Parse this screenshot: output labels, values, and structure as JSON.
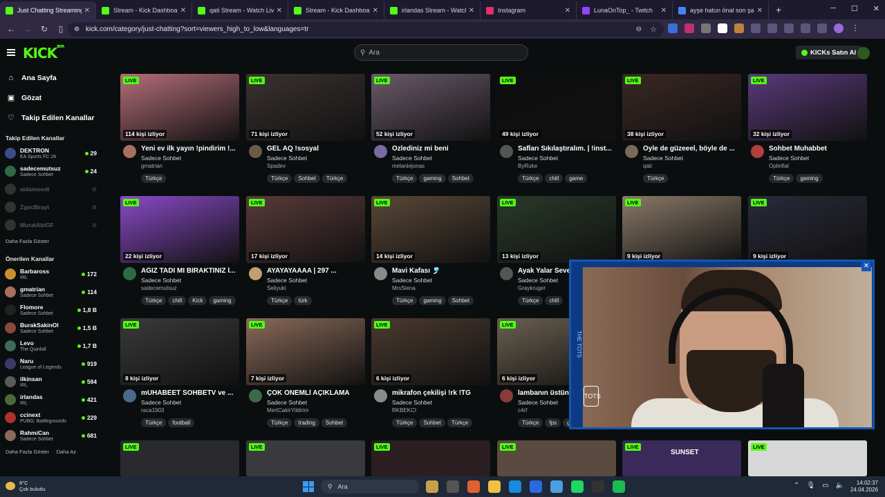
{
  "browser": {
    "tabs": [
      {
        "label": "Just Chatting Streaming",
        "active": true,
        "color": "#53fc18"
      },
      {
        "label": "Stream - Kick Dashboard",
        "color": "#53fc18"
      },
      {
        "label": "qati Stream - Watch Live o",
        "color": "#53fc18"
      },
      {
        "label": "Stream - Kick Dashboard",
        "color": "#53fc18"
      },
      {
        "label": "irlandas Stream - Watch Li",
        "color": "#53fc18"
      },
      {
        "label": "Instagram",
        "color": "#e1306c"
      },
      {
        "label": "LunaOnTop_ - Twitch",
        "color": "#9146ff"
      },
      {
        "label": "ayşe hatun önal son şarkı",
        "color": "#4285f4"
      }
    ],
    "new_tab": "+",
    "url": "kick.com/category/just-chatting?sort=viewers_high_to_low&languages=tr"
  },
  "header": {
    "logo": "KICK",
    "logo_sup": "BETA",
    "search_placeholder": "Ara",
    "kicks_button": "KICKs Satın Al"
  },
  "sidebar": {
    "nav": [
      {
        "label": "Ana Sayfa",
        "icon": "home-icon",
        "glyph": "⌂"
      },
      {
        "label": "Gözat",
        "icon": "browse-icon",
        "glyph": "▣"
      },
      {
        "label": "Takip Edilen Kanallar",
        "icon": "heart-icon",
        "glyph": "♡"
      }
    ],
    "followed_header": "Takip Edilen Kanallar",
    "followed": [
      {
        "name": "DEKTRON",
        "sub": "EA Sports FC 26",
        "count": "29",
        "live": true,
        "color": "#3a4d8a"
      },
      {
        "name": "sadecemutsuz",
        "sub": "Sadece Sohbet",
        "count": "24",
        "live": true,
        "color": "#2f6a45"
      },
      {
        "name": "aidamoodi",
        "sub": "",
        "count": "",
        "live": false,
        "color": "#777"
      },
      {
        "name": "ZgocBrayt",
        "sub": "",
        "count": "",
        "live": false,
        "color": "#777"
      },
      {
        "name": "MuratAbiGF",
        "sub": "",
        "count": "",
        "live": false,
        "color": "#777"
      }
    ],
    "more1": "Daha Fazla Göster",
    "recommended_header": "Önerilen Kanallar",
    "recommended": [
      {
        "name": "Barbaross",
        "sub": "IRL",
        "count": "172",
        "color": "#c9902e"
      },
      {
        "name": "gmatrian",
        "sub": "Sadece Sohbet",
        "count": "114",
        "color": "#a87060"
      },
      {
        "name": "Flomore",
        "sub": "Sadece Sohbet",
        "count": "1,8 B",
        "color": "#222"
      },
      {
        "name": "BurakSakinOl",
        "sub": "Sadece Sohbet",
        "count": "1,5 B",
        "color": "#8a4a3a"
      },
      {
        "name": "Levo",
        "sub": "The Quinfall",
        "count": "1,7 B",
        "color": "#3f6a5a"
      },
      {
        "name": "Naru",
        "sub": "League of Legends",
        "count": "919",
        "color": "#3a3a6a"
      },
      {
        "name": "ilkinsan",
        "sub": "IRL",
        "count": "594",
        "color": "#5a5a5a"
      },
      {
        "name": "irlandas",
        "sub": "IRL",
        "count": "421",
        "color": "#4a6a3a"
      },
      {
        "name": "ccinext",
        "sub": "PUBG: Battlegrounds",
        "count": "229",
        "color": "#b03030"
      },
      {
        "name": "RahmiCan",
        "sub": "Sadece Sohbet",
        "count": "681",
        "color": "#8a6a5a"
      }
    ],
    "more2": "Daha Fazla Göster",
    "less": "Daha Az"
  },
  "live_label": "LIVE",
  "cards": [
    {
      "title": "Yeni ev ilk yayın !pindirim !...",
      "cat": "Sadece Sohbet",
      "user": "gmatrian",
      "viewers": "114 kişi izliyor",
      "tags": [
        "Türkçe"
      ],
      "bg": "#b56e7a",
      "av": "#a87060"
    },
    {
      "title": "GEL AQ !sosyal",
      "cat": "Sadece Sohbet",
      "user": "Spadev",
      "viewers": "71 kişi izliyor",
      "tags": [
        "Türkçe",
        "Sohbet",
        "Türkçe"
      ],
      "bg": "#3a3230",
      "av": "#6a5a4a"
    },
    {
      "title": "Özlediniz mi beni",
      "cat": "Sadece Sohbet",
      "user": "melaniejonas",
      "viewers": "52 kişi izliyor",
      "tags": [
        "Türkçe",
        "gaming",
        "Sohbet"
      ],
      "bg": "#6a5a6a",
      "av": "#7a6aa0"
    },
    {
      "title": "Safları Sıkılaştıralım. | !inst...",
      "cat": "Sadece Sohbet",
      "user": "ByRuke",
      "viewers": "49 kişi izliyor",
      "tags": [
        "Türkçe",
        "chill",
        "game"
      ],
      "bg": "#0e0e10",
      "av": "#555"
    },
    {
      "title": "Öyle de güzeeel, böyle de ...",
      "cat": "Sadece Sohbet",
      "user": "qati",
      "viewers": "38 kişi izliyor",
      "tags": [
        "Türkçe"
      ],
      "bg": "#3a2824",
      "av": "#7a6a5a"
    },
    {
      "title": "Sohbet Muhabbet",
      "cat": "Sadece Sohbet",
      "user": "Oplinfial",
      "viewers": "32 kişi izliyor",
      "tags": [
        "Türkçe",
        "gaming"
      ],
      "bg": "#5a3a7a",
      "av": "#b04040"
    },
    {
      "title": "AĞIZ TADI MI BIRAKTINIZ İ...",
      "cat": "Sadece Sohbet",
      "user": "sadecemutsuz",
      "viewers": "22 kişi izliyor",
      "tags": [
        "Türkçe",
        "chill",
        "Kick",
        "gaming"
      ],
      "bg": "#8a4ac8",
      "av": "#2f6a45"
    },
    {
      "title": "AYAYAYAAAA | 297 ...",
      "cat": "Sadece Sohbet",
      "user": "Seliyuki",
      "viewers": "17 kişi izliyor",
      "tags": [
        "Türkçe",
        "türk"
      ],
      "bg": "#5a3a3a",
      "av": "#c0a070"
    },
    {
      "title": "Mavi Kafası 🎐",
      "cat": "Sadece Sohbet",
      "user": "MrsSiena",
      "viewers": "14 kişi izliyor",
      "tags": [
        "Türkçe",
        "gaming",
        "Sohbet"
      ],
      "bg": "#5a4838",
      "av": "#8a8a8a"
    },
    {
      "title": "Ayak Yalar Seve",
      "cat": "Sadece Sohbet",
      "user": "Graykruger",
      "viewers": "13 kişi izliyor",
      "tags": [
        "Türkçe",
        "chill"
      ],
      "bg": "#2a3a2a",
      "av": "#555"
    },
    {
      "title": "",
      "cat": "",
      "user": "",
      "viewers": "9 kişi izliyor",
      "tags": [],
      "bg": "#8a7a68",
      "av": "#555"
    },
    {
      "title": "",
      "cat": "",
      "user": "",
      "viewers": "9 kişi izliyor",
      "tags": [],
      "bg": "#2a2a3a",
      "av": "#555"
    },
    {
      "title": "mUHABEET SOHBETV ve ...",
      "cat": "Sadece Sohbet",
      "user": "raca1903",
      "viewers": "8 kişi izliyor",
      "tags": [
        "Türkçe",
        "football"
      ],
      "bg": "#3a3a3a",
      "av": "#4a6a8a"
    },
    {
      "title": "ÇOK ÖNEMLİ AÇIKLAMA",
      "cat": "Sadece Sohbet",
      "user": "MertCakirYildirim",
      "viewers": "7 kişi izliyor",
      "tags": [
        "Türkçe",
        "trading",
        "Sohbet"
      ],
      "bg": "#8a6a58",
      "av": "#3a6a4a"
    },
    {
      "title": "mikrafon çekilişi !rk !TG",
      "cat": "Sadece Sohbet",
      "user": "RKBEKCI",
      "viewers": "6 kişi izliyor",
      "tags": [
        "Türkçe",
        "Sohbet",
        "Türkçe"
      ],
      "bg": "#4a3a30",
      "av": "#8a8a8a"
    },
    {
      "title": "lambanın üstünd",
      "cat": "Sadece Sohbet",
      "user": "c4rf",
      "viewers": "6 kişi izliyor",
      "tags": [
        "Türkçe",
        "fps",
        "g"
      ],
      "bg": "#6a6050",
      "av": "#8a3a3a"
    }
  ],
  "bottom_row": [
    {
      "bg": "#2a2a2e"
    },
    {
      "bg": "#3a3a3e"
    },
    {
      "bg": "#2a1e20"
    },
    {
      "bg": "#5a4a40"
    },
    {
      "bg": "#3a2a5a",
      "label": "SUNSET"
    },
    {
      "bg": "#d8d8d8"
    }
  ],
  "pip": {
    "side_text": "THE TOTS",
    "badge": "TOTS"
  },
  "taskbar": {
    "temp": "8°C",
    "weather": "Çok bulutlu",
    "search": "Ara",
    "time": "14:02:37",
    "date": "24.04.2026",
    "apps": [
      "#c8a04a",
      "#555",
      "#e06030",
      "#f0c040",
      "#1a8ae0",
      "#2a6ae0",
      "#4aa0e0",
      "#1ed760",
      "#333",
      "#1db954"
    ]
  }
}
